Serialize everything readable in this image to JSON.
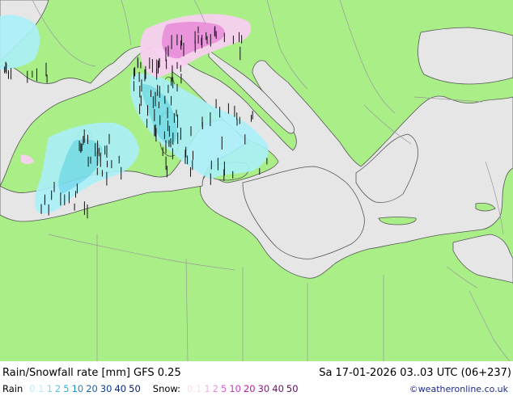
{
  "title": "Rain/Snowfall rate [mm] GFS 0.25",
  "run_info": "Sa 17-01-2026 03..03 UTC (06+237)",
  "legend": {
    "rain_label": "Rain",
    "rain_values": [
      {
        "text": "0.1",
        "color": "#b4f0fa"
      },
      {
        "text": "1",
        "color": "#78dcf0"
      },
      {
        "text": "2",
        "color": "#50c8e6"
      },
      {
        "text": "5",
        "color": "#2ab4dc"
      },
      {
        "text": "10",
        "color": "#1e8cd2"
      },
      {
        "text": "20",
        "color": "#1464b4"
      },
      {
        "text": "30",
        "color": "#0a3c96"
      },
      {
        "text": "40",
        "color": "#0a2878"
      },
      {
        "text": "50",
        "color": "#0a1e5a"
      }
    ],
    "snow_label": "Snow:",
    "snow_values": [
      {
        "text": "0.1",
        "color": "#fadcf0"
      },
      {
        "text": "1",
        "color": "#f0b4e6"
      },
      {
        "text": "2",
        "color": "#e68cdc"
      },
      {
        "text": "5",
        "color": "#dc5ad2"
      },
      {
        "text": "10",
        "color": "#c83cbe"
      },
      {
        "text": "20",
        "color": "#b41ea0"
      },
      {
        "text": "30",
        "color": "#961482"
      },
      {
        "text": "40",
        "color": "#780a6e"
      },
      {
        "text": "50",
        "color": "#5a0a5a"
      }
    ]
  },
  "credit": "©weatheronline.co.uk",
  "colors": {
    "land": "#aaee88",
    "sea": "#e6e6e6",
    "rain_light": "#aaf0f8",
    "rain_mid": "#78dcf0",
    "snow_light": "#f8d0f0",
    "snow_mid": "#ee90e0",
    "border": "#9a9a9a",
    "coast": "#555555"
  }
}
